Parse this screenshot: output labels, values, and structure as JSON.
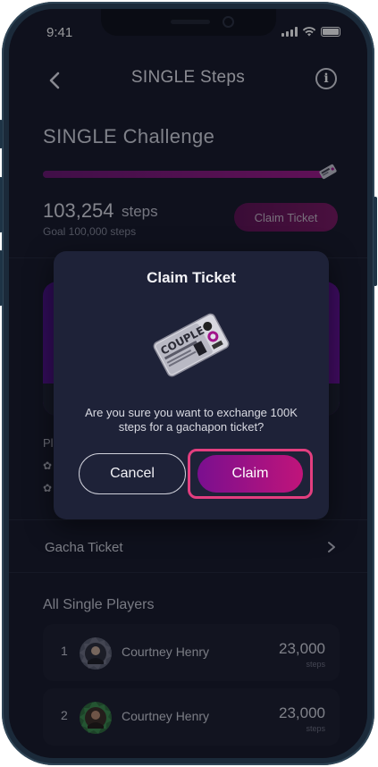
{
  "status_bar": {
    "time": "9:41"
  },
  "header": {
    "title": "SINGLE Steps",
    "info_label": "i"
  },
  "challenge": {
    "title": "SINGLE Challenge",
    "progress_fraction": 1.0,
    "steps": "103,254",
    "steps_unit": "steps",
    "goal": "Goal 100,000 steps",
    "claim_button": "Claim Ticket"
  },
  "background_section": {
    "label_partial": "Pl"
  },
  "gacha": {
    "label": "Gacha Ticket"
  },
  "leaderboard": {
    "title": "All Single Players",
    "players": [
      {
        "rank": "1",
        "name": "Courtney Henry",
        "steps": "23,000",
        "unit": "steps"
      },
      {
        "rank": "2",
        "name": "Courtney Henry",
        "steps": "23,000",
        "unit": "steps"
      }
    ]
  },
  "modal": {
    "title": "Claim Ticket",
    "message": "Are you sure you want to exchange 100K steps for a gachapon ticket?",
    "cancel_label": "Cancel",
    "claim_label": "Claim",
    "ticket_text": "COUPLE"
  },
  "colors": {
    "background": "#151726",
    "modal_bg": "#1e2238",
    "accent_start": "#7a0f8f",
    "accent_end": "#c0147a",
    "highlight_ring": "#e33e7f"
  }
}
